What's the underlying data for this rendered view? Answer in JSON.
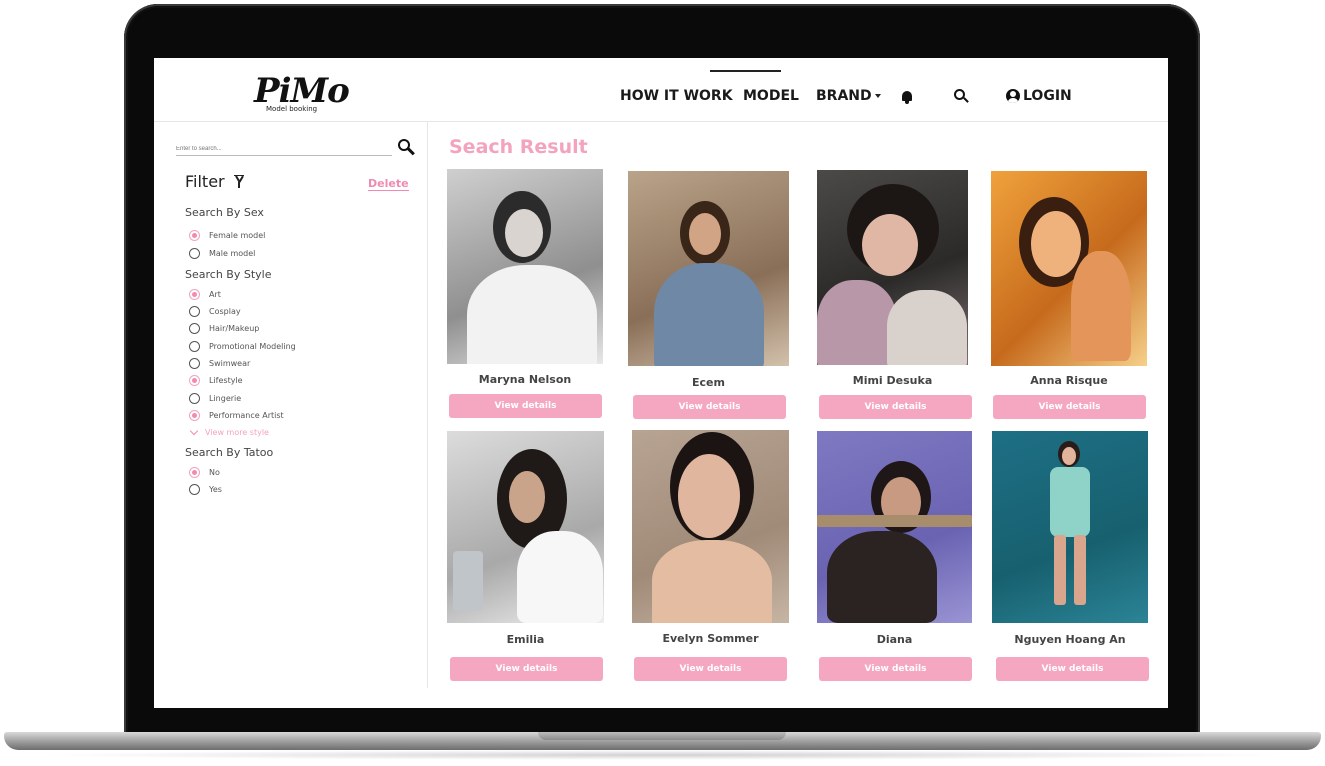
{
  "brand": {
    "logo_text": "PiMo",
    "tagline": "Model booking"
  },
  "nav": {
    "items": [
      "HOW IT WORK",
      "MODEL",
      "BRAND"
    ],
    "active": "MODEL",
    "login": "LOGIN"
  },
  "icons": [
    "bell-icon",
    "search-icon",
    "user-icon",
    "filter-icon",
    "chevron-down-icon"
  ],
  "sidebar": {
    "search_placeholder": "Enter to search...",
    "filter_title": "Filter",
    "delete_label": "Delete",
    "groups": [
      {
        "title": "Search By Sex",
        "options": [
          {
            "label": "Female model",
            "checked": true
          },
          {
            "label": "Male model",
            "checked": false
          }
        ]
      },
      {
        "title": "Search By Style",
        "options": [
          {
            "label": "Art",
            "checked": true
          },
          {
            "label": "Cosplay",
            "checked": false
          },
          {
            "label": "Hair/Makeup",
            "checked": false
          },
          {
            "label": "Promotional Modeling",
            "checked": false
          },
          {
            "label": "Swimwear",
            "checked": false
          },
          {
            "label": "Lifestyle",
            "checked": true
          },
          {
            "label": "Lingerie",
            "checked": false
          },
          {
            "label": "Performance Artist",
            "checked": true
          }
        ]
      },
      {
        "title": "Search By Tatoo",
        "options": [
          {
            "label": "No",
            "checked": true
          },
          {
            "label": "Yes",
            "checked": false
          }
        ]
      }
    ],
    "view_more": "View more style"
  },
  "results": {
    "title": "Seach Result",
    "button_label": "View details",
    "models": [
      {
        "name": "Maryna Nelson"
      },
      {
        "name": "Ecem"
      },
      {
        "name": "Mimi Desuka"
      },
      {
        "name": "Anna Risque"
      },
      {
        "name": "Emilia"
      },
      {
        "name": "Evelyn Sommer"
      },
      {
        "name": "Diana"
      },
      {
        "name": "Nguyen Hoang An"
      }
    ]
  },
  "colors": {
    "accent": "#f5a6c0",
    "accent_text": "#f3a3be",
    "text": "#1a1a1a"
  }
}
